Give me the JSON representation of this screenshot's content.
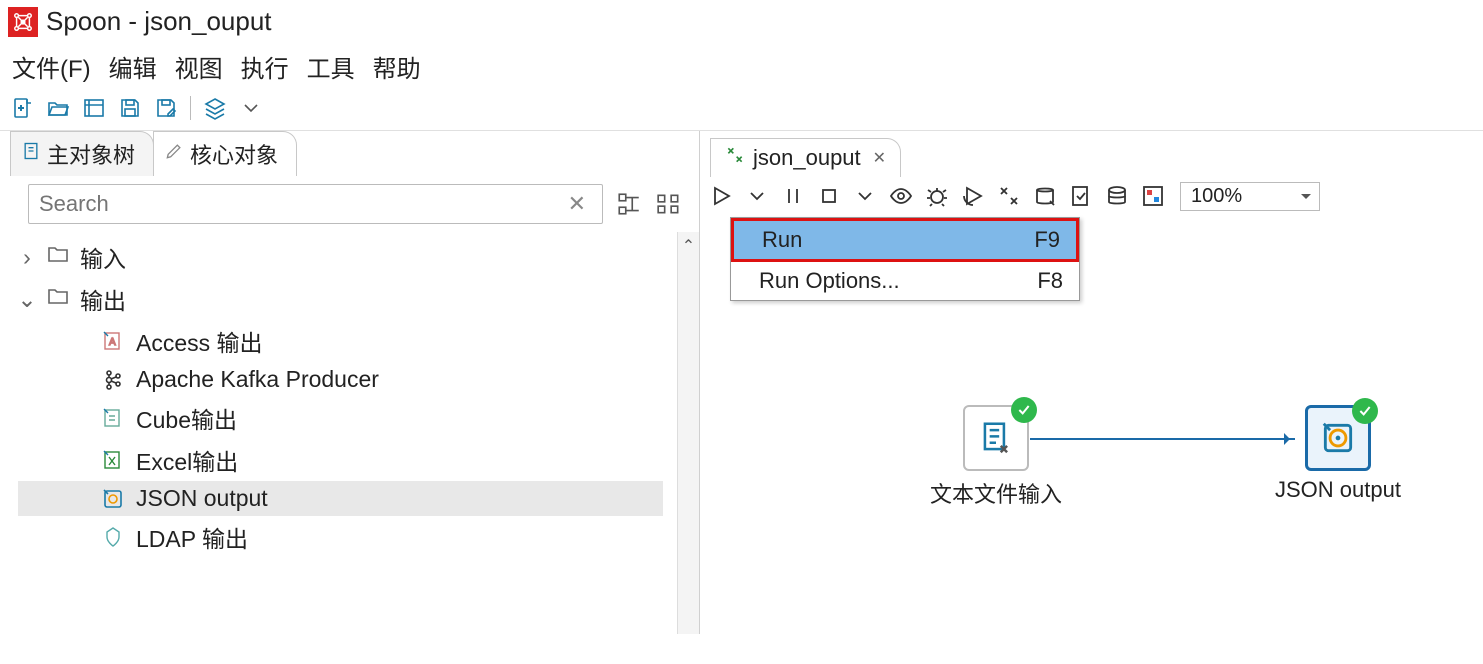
{
  "title": "Spoon - json_ouput",
  "menu": {
    "file": "文件(F)",
    "edit": "编辑",
    "view": "视图",
    "run": "执行",
    "tools": "工具",
    "help": "帮助"
  },
  "left_tabs": {
    "t1": "主对象树",
    "t2": "核心对象"
  },
  "search": {
    "placeholder": "Search"
  },
  "tree": {
    "n1": "输入",
    "n2": "输出",
    "c1": "Access 输出",
    "c2": "Apache Kafka Producer",
    "c3": "Cube输出",
    "c4": "Excel输出",
    "c5": "JSON output",
    "c6": "LDAP 输出"
  },
  "right_tab": "json_ouput",
  "zoom": "100%",
  "dropdown": {
    "run": {
      "label": "Run",
      "key": "F9"
    },
    "runopts": {
      "label": "Run Options...",
      "key": "F8"
    }
  },
  "canvas": {
    "step1": "文本文件输入",
    "step2": "JSON output"
  }
}
